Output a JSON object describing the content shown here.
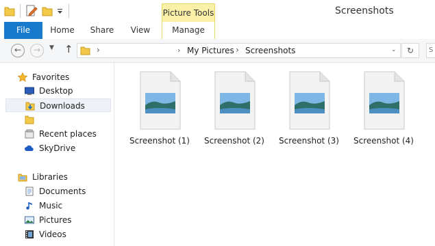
{
  "window": {
    "title": "Screenshots",
    "context_tab": "Picture Tools"
  },
  "ribbon": {
    "tabs": [
      {
        "label": "File"
      },
      {
        "label": "Home"
      },
      {
        "label": "Share"
      },
      {
        "label": "View"
      },
      {
        "label": "Manage"
      }
    ]
  },
  "address": {
    "breadcrumb": [
      "My Pictures",
      "Screenshots"
    ],
    "separator": "›"
  },
  "nav": {
    "favorites_label": "Favorites",
    "favorites": [
      {
        "label": "Desktop",
        "icon": "desktop-icon"
      },
      {
        "label": "Downloads",
        "icon": "downloads-icon",
        "selected": true
      },
      {
        "label": "",
        "icon": "folder-icon"
      },
      {
        "label": "Recent places",
        "icon": "recent-places-icon"
      },
      {
        "label": "SkyDrive",
        "icon": "skydrive-icon"
      }
    ],
    "libraries_label": "Libraries",
    "libraries": [
      {
        "label": "Documents",
        "icon": "documents-icon"
      },
      {
        "label": "Music",
        "icon": "music-icon"
      },
      {
        "label": "Pictures",
        "icon": "pictures-icon"
      },
      {
        "label": "Videos",
        "icon": "videos-icon"
      }
    ]
  },
  "files": [
    {
      "name": "Screenshot (1)"
    },
    {
      "name": "Screenshot (2)"
    },
    {
      "name": "Screenshot (3)"
    },
    {
      "name": "Screenshot (4)"
    }
  ],
  "colors": {
    "accent": "#1979ca",
    "context": "#faf0a8"
  }
}
